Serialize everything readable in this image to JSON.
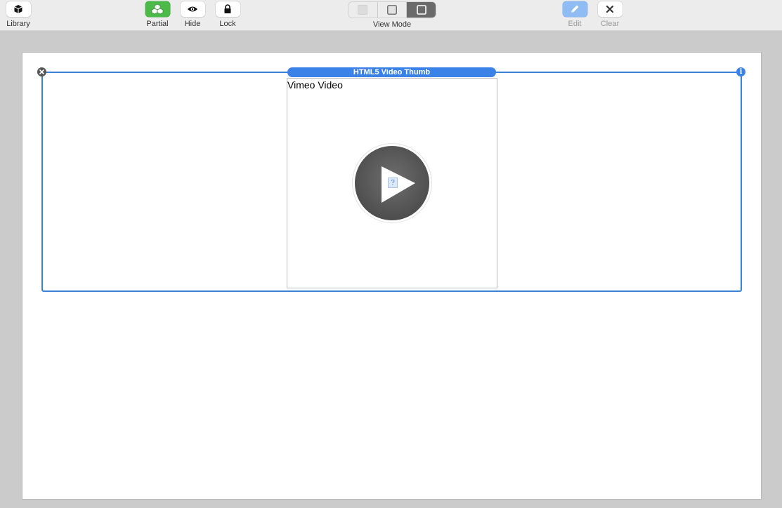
{
  "toolbar": {
    "library": {
      "label": "Library",
      "icon": "cube-icon"
    },
    "partial": {
      "label": "Partial",
      "icon": "blocks-icon",
      "color": "#4cba48"
    },
    "hide": {
      "label": "Hide",
      "icon": "eye-icon"
    },
    "lock": {
      "label": "Lock",
      "icon": "lock-icon"
    },
    "view_mode": {
      "label": "View Mode",
      "options": [
        "filled",
        "outline",
        "bordered"
      ],
      "selected_index": 2
    },
    "edit": {
      "label": "Edit",
      "icon": "pencil-icon",
      "enabled": false,
      "color": "#8fbdf3"
    },
    "clear": {
      "label": "Clear",
      "icon": "x-icon",
      "enabled": false
    }
  },
  "canvas": {
    "selection": {
      "title": "HTML5 Video Thumb",
      "accent_color": "#3b82e8"
    },
    "video": {
      "label": "Vimeo Video",
      "broken_image_glyph": "?"
    }
  }
}
